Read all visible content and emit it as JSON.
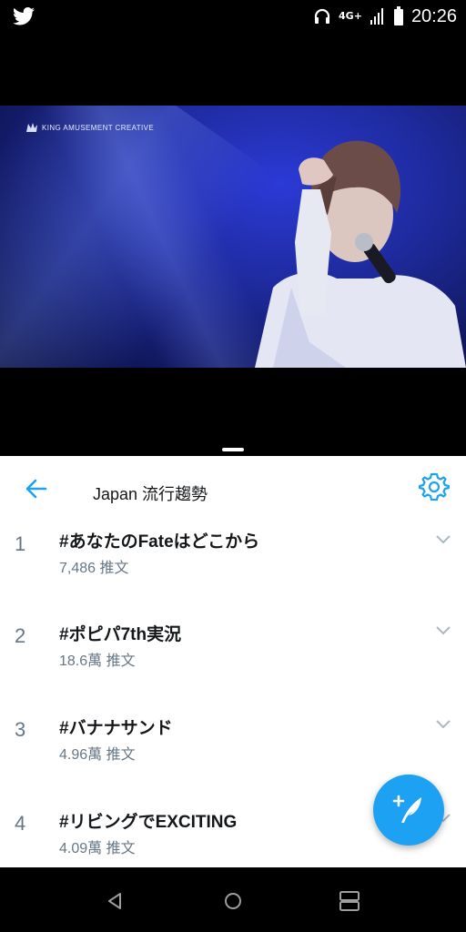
{
  "status_bar": {
    "time": "20:26",
    "network": "4G+",
    "icons": [
      "twitter-bird-icon",
      "headphones-icon",
      "signal-icon",
      "battery-icon"
    ]
  },
  "video": {
    "watermark": "KING AMUSEMENT CREATIVE"
  },
  "header": {
    "title": "Japan 流行趨勢",
    "back_icon": "arrow-left-icon",
    "settings_icon": "gear-icon"
  },
  "trends": [
    {
      "rank": "1",
      "name": "#あなたのFateはどこから",
      "count": "7,486 推文"
    },
    {
      "rank": "2",
      "name": "#ポピパ7th実況",
      "count": "18.6萬 推文"
    },
    {
      "rank": "3",
      "name": "#バナナサンド",
      "count": "4.96萬 推文"
    },
    {
      "rank": "4",
      "name": "#リビングでEXCITING",
      "count": "4.09萬 推文"
    }
  ],
  "fab": {
    "icon": "compose-tweet-icon"
  },
  "nav": {
    "icons": [
      "back-triangle-icon",
      "home-circle-icon",
      "recents-icon"
    ]
  },
  "colors": {
    "accent": "#1da1f2",
    "secondary_text": "#657786",
    "primary_text": "#14171a",
    "divider": "#d6dde3"
  }
}
